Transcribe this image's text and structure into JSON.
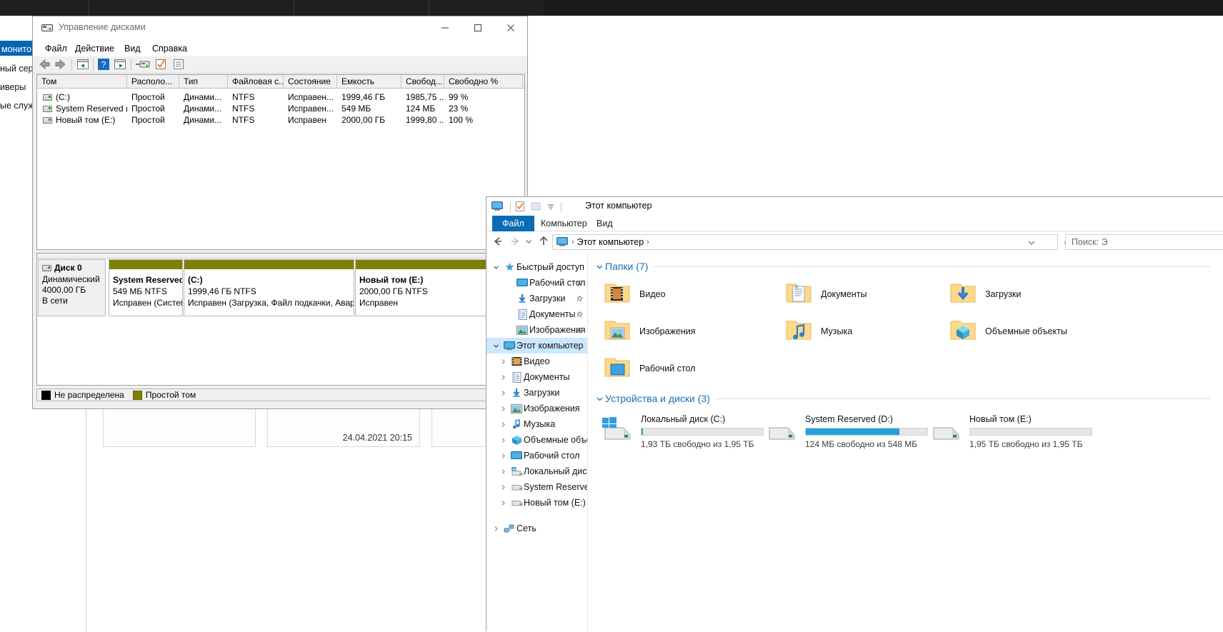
{
  "background": {
    "left_panel_items": [
      "монито",
      "ный сер",
      "иверы",
      "ые служ"
    ],
    "record_timestamp": "24.04.2021 20:15"
  },
  "disk_management": {
    "title": "Управление дисками",
    "title_icon": "disk-management-icon",
    "window_controls": {
      "minimize": "minimize-icon",
      "maximize": "maximize-icon",
      "close": "close-icon"
    },
    "menu": [
      "Файл",
      "Действие",
      "Вид",
      "Справка"
    ],
    "toolbar_icons": [
      "back-arrow-icon",
      "forward-arrow-icon",
      "show-hide-tree-icon",
      "help-icon",
      "properties-icon",
      "rescan-disks-icon",
      "check-icon",
      "list-icon"
    ],
    "volumes": {
      "columns": [
        "Том",
        "Располо...",
        "Тип",
        "Файловая с...",
        "Состояние",
        "Емкость",
        "Свобод...",
        "Свободно %"
      ],
      "rows": [
        {
          "volume": "(C:)",
          "layout": "Простой",
          "type": "Динами...",
          "fs": "NTFS",
          "status": "Исправен...",
          "capacity": "1999,46 ГБ",
          "free": "1985,75 ...",
          "free_pct": "99 %"
        },
        {
          "volume": "System Reserved (...",
          "layout": "Простой",
          "type": "Динами...",
          "fs": "NTFS",
          "status": "Исправен...",
          "capacity": "549 МБ",
          "free": "124 МБ",
          "free_pct": "23 %"
        },
        {
          "volume": "Новый том (E:)",
          "layout": "Простой",
          "type": "Динами...",
          "fs": "NTFS",
          "status": "Исправен",
          "capacity": "2000,00 ГБ",
          "free": "1999,80 ...",
          "free_pct": "100 %"
        }
      ]
    },
    "disk_graphic": {
      "disk_label": "Диск 0",
      "disk_type": "Динамический",
      "disk_size": "4000,00 ГБ",
      "disk_state": "В сети",
      "partitions": [
        {
          "name": "System Reserved",
          "size_fs": "549 МБ NTFS",
          "status": "Исправен (Систем"
        },
        {
          "name": "(C:)",
          "size_fs": "1999,46 ГБ NTFS",
          "status": "Исправен (Загрузка, Файл подкачки, Аварий"
        },
        {
          "name": "Новый том  (E:)",
          "size_fs": "2000,00 ГБ NTFS",
          "status": "Исправен"
        }
      ]
    },
    "legend": [
      {
        "label": "Не распределена",
        "color": "#000000"
      },
      {
        "label": "Простой том",
        "color": "#808000"
      }
    ]
  },
  "explorer": {
    "title": "Этот компьютер",
    "quick_access_icons": [
      "this-pc-icon",
      "properties-icon",
      "new-folder-icon",
      "customize-toolbar-chevron-icon"
    ],
    "ribbon_tabs": [
      {
        "label": "Файл",
        "active": true
      },
      {
        "label": "Компьютер",
        "active": false
      },
      {
        "label": "Вид",
        "active": false
      }
    ],
    "address": {
      "breadcrumb": [
        "Этот компьютер"
      ],
      "icon": "this-pc-icon"
    },
    "search_placeholder": "Поиск: Э",
    "nav_tree": [
      {
        "label": "Быстрый доступ",
        "icon": "star-pin-icon",
        "expanded": true,
        "indent": 0,
        "selected": false,
        "pinned": false
      },
      {
        "label": "Рабочий стол",
        "icon": "desktop-icon",
        "expanded": null,
        "indent": 1,
        "selected": false,
        "pinned": true
      },
      {
        "label": "Загрузки",
        "icon": "downloads-icon",
        "expanded": null,
        "indent": 1,
        "selected": false,
        "pinned": true
      },
      {
        "label": "Документы",
        "icon": "documents-icon",
        "expanded": null,
        "indent": 1,
        "selected": false,
        "pinned": true
      },
      {
        "label": "Изображения",
        "icon": "pictures-icon",
        "expanded": null,
        "indent": 1,
        "selected": false,
        "pinned": true
      },
      {
        "label": "Этот компьютер",
        "icon": "this-pc-icon",
        "expanded": true,
        "indent": 0,
        "selected": true,
        "pinned": false
      },
      {
        "label": "Видео",
        "icon": "videos-icon",
        "expanded": false,
        "indent": 1,
        "selected": false,
        "pinned": false
      },
      {
        "label": "Документы",
        "icon": "documents-icon",
        "expanded": false,
        "indent": 1,
        "selected": false,
        "pinned": false
      },
      {
        "label": "Загрузки",
        "icon": "downloads-icon",
        "expanded": false,
        "indent": 1,
        "selected": false,
        "pinned": false
      },
      {
        "label": "Изображения",
        "icon": "pictures-icon",
        "expanded": false,
        "indent": 1,
        "selected": false,
        "pinned": false
      },
      {
        "label": "Музыка",
        "icon": "music-icon",
        "expanded": false,
        "indent": 1,
        "selected": false,
        "pinned": false
      },
      {
        "label": "Объемные объекты",
        "icon": "3d-objects-icon",
        "expanded": false,
        "indent": 1,
        "selected": false,
        "pinned": false
      },
      {
        "label": "Рабочий стол",
        "icon": "desktop-icon",
        "expanded": false,
        "indent": 1,
        "selected": false,
        "pinned": false
      },
      {
        "label": "Локальный диск (C",
        "icon": "windows-drive-icon",
        "expanded": false,
        "indent": 1,
        "selected": false,
        "pinned": false
      },
      {
        "label": "System Reserved (D",
        "icon": "drive-icon",
        "expanded": false,
        "indent": 1,
        "selected": false,
        "pinned": false
      },
      {
        "label": "Новый том (E:)",
        "icon": "drive-icon",
        "expanded": false,
        "indent": 1,
        "selected": false,
        "pinned": false
      },
      {
        "label": "Сеть",
        "icon": "network-icon",
        "expanded": false,
        "indent": 0,
        "selected": false,
        "pinned": false
      }
    ],
    "groups": {
      "folders": {
        "title": "Папки (7)",
        "items": [
          {
            "label": "Видео",
            "icon": "folder-videos-icon"
          },
          {
            "label": "Документы",
            "icon": "folder-documents-icon"
          },
          {
            "label": "Загрузки",
            "icon": "folder-downloads-icon"
          },
          {
            "label": "Изображения",
            "icon": "folder-pictures-icon"
          },
          {
            "label": "Музыка",
            "icon": "folder-music-icon"
          },
          {
            "label": "Объемные объекты",
            "icon": "folder-3d-objects-icon"
          },
          {
            "label": "Рабочий стол",
            "icon": "folder-desktop-icon"
          }
        ]
      },
      "devices": {
        "title": "Устройства и диски (3)",
        "items": [
          {
            "label": "Локальный диск (C:)",
            "icon": "windows-drive-icon",
            "free_text": "1,93 ТБ свободно из 1,95 ТБ",
            "used_pct": 1
          },
          {
            "label": "System Reserved (D:)",
            "icon": "drive-icon",
            "free_text": "124 МБ свободно из 548 МБ",
            "used_pct": 77
          },
          {
            "label": "Новый том (E:)",
            "icon": "drive-icon",
            "free_text": "1,95 ТБ свободно из 1,95 ТБ",
            "used_pct": 0
          }
        ]
      }
    }
  }
}
